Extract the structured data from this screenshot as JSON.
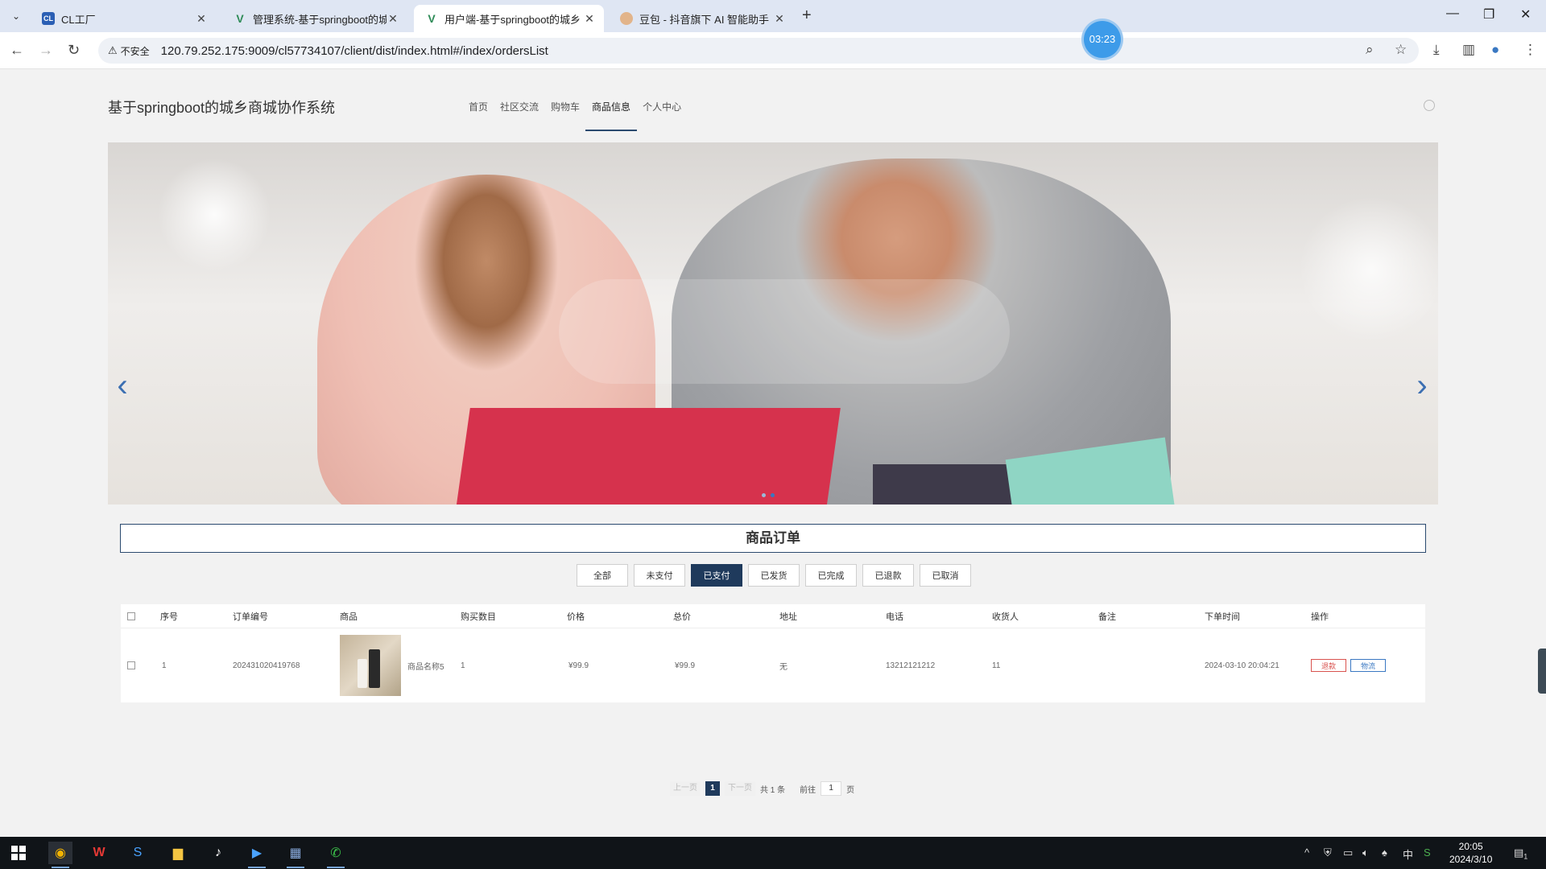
{
  "browser": {
    "tabs": [
      {
        "label": "CL工厂",
        "favicon": "cl-favicon-icon",
        "active": false
      },
      {
        "label": "管理系统-基于springboot的城",
        "favicon": "vue-favicon-icon",
        "active": false
      },
      {
        "label": "用户端-基于springboot的城乡",
        "favicon": "vue-favicon-icon",
        "active": true
      },
      {
        "label": "豆包 - 抖音旗下 AI 智能助手",
        "favicon": "doubao-favicon-icon",
        "active": false
      }
    ],
    "new_tab": "+",
    "timer": "03:23",
    "security_label": "不安全",
    "url": "120.79.252.175:9009/cl57734107/client/dist/index.html#/index/ordersList"
  },
  "site": {
    "title": "基于springboot的城乡商城协作系统",
    "nav": [
      {
        "label": "首页",
        "active": false
      },
      {
        "label": "社区交流",
        "active": false
      },
      {
        "label": "购物车",
        "active": false
      },
      {
        "label": "商品信息",
        "active": true
      },
      {
        "label": "个人中心",
        "active": false
      }
    ]
  },
  "banner": {
    "dots": 2,
    "active_dot": 1
  },
  "orders": {
    "section_title": "商品订单",
    "filters": [
      {
        "label": "全部",
        "active": false
      },
      {
        "label": "未支付",
        "active": false
      },
      {
        "label": "已支付",
        "active": true
      },
      {
        "label": "已发货",
        "active": false
      },
      {
        "label": "已完成",
        "active": false
      },
      {
        "label": "已退款",
        "active": false
      },
      {
        "label": "已取消",
        "active": false
      }
    ],
    "columns": [
      "序号",
      "订单编号",
      "商品",
      "购买数目",
      "价格",
      "总价",
      "地址",
      "电话",
      "收货人",
      "备注",
      "下单时间",
      "操作"
    ],
    "rows": [
      {
        "index": "1",
        "order_no": "202431020419768",
        "product_name": "商品名称5",
        "quantity": "1",
        "price": "¥99.9",
        "total": "¥99.9",
        "address": "无",
        "phone": "13212121212",
        "receiver": "11",
        "remark": "",
        "order_time": "2024-03-10 20:04:21",
        "actions": [
          "退款",
          "物流"
        ]
      }
    ],
    "pager": {
      "prev": "上一页",
      "current": "1",
      "next": "下一页",
      "total": "共 1 条",
      "goto_prefix": "前往",
      "goto_value": "1",
      "goto_suffix": "页"
    }
  },
  "taskbar": {
    "time": "20:05",
    "date": "2024/3/10",
    "ime": "中",
    "notifications": "1"
  }
}
